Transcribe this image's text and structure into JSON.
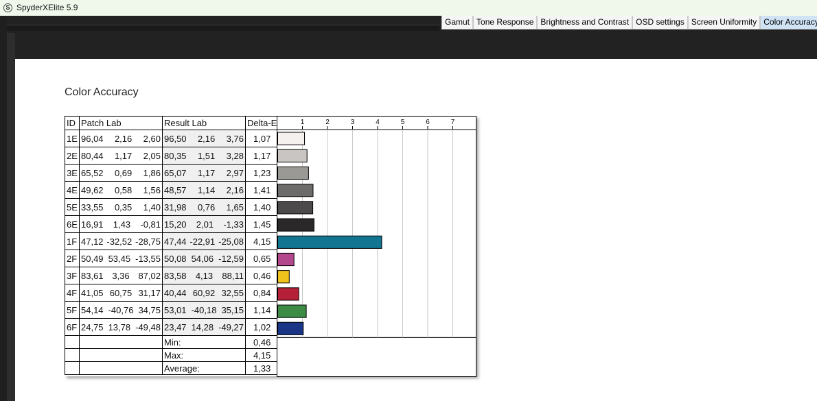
{
  "app": {
    "title": "SpyderXElite 5.9",
    "icon": "S"
  },
  "tabs": [
    "Gamut",
    "Tone Response",
    "Brightness and Contrast",
    "OSD settings",
    "Screen Uniformity",
    "Color Accuracy"
  ],
  "active_tab": "Color Accuracy",
  "section_title": "Color Accuracy",
  "table": {
    "headers": {
      "id": "ID",
      "patch": "Patch Lab",
      "result": "Result Lab",
      "delta": "Delta-E"
    },
    "rows": [
      {
        "id": "1E",
        "patch": [
          "96,04",
          "2,16",
          "2,60"
        ],
        "result": [
          "96,50",
          "2,16",
          "3,76"
        ],
        "delta": "1,07"
      },
      {
        "id": "2E",
        "patch": [
          "80,44",
          "1,17",
          "2,05"
        ],
        "result": [
          "80,35",
          "1,51",
          "3,28"
        ],
        "delta": "1,17"
      },
      {
        "id": "3E",
        "patch": [
          "65,52",
          "0,69",
          "1,86"
        ],
        "result": [
          "65,07",
          "1,17",
          "2,97"
        ],
        "delta": "1,23"
      },
      {
        "id": "4E",
        "patch": [
          "49,62",
          "0,58",
          "1,56"
        ],
        "result": [
          "48,57",
          "1,14",
          "2,16"
        ],
        "delta": "1,41"
      },
      {
        "id": "5E",
        "patch": [
          "33,55",
          "0,35",
          "1,40"
        ],
        "result": [
          "31,98",
          "0,76",
          "1,65"
        ],
        "delta": "1,40"
      },
      {
        "id": "6E",
        "patch": [
          "16,91",
          "1,43",
          "-0,81"
        ],
        "result": [
          "15,20",
          "2,01",
          "-1,33"
        ],
        "delta": "1,45"
      },
      {
        "id": "1F",
        "patch": [
          "47,12",
          "-32,52",
          "-28,75"
        ],
        "result": [
          "47,44",
          "-22,91",
          "-25,08"
        ],
        "delta": "4,15"
      },
      {
        "id": "2F",
        "patch": [
          "50,49",
          "53,45",
          "-13,55"
        ],
        "result": [
          "50,08",
          "54,06",
          "-12,59"
        ],
        "delta": "0,65"
      },
      {
        "id": "3F",
        "patch": [
          "83,61",
          "3,36",
          "87,02"
        ],
        "result": [
          "83,58",
          "4,13",
          "88,11"
        ],
        "delta": "0,46"
      },
      {
        "id": "4F",
        "patch": [
          "41,05",
          "60,75",
          "31,17"
        ],
        "result": [
          "40,44",
          "60,92",
          "32,55"
        ],
        "delta": "0,84"
      },
      {
        "id": "5F",
        "patch": [
          "54,14",
          "-40,76",
          "34,75"
        ],
        "result": [
          "53,01",
          "-40,18",
          "35,15"
        ],
        "delta": "1,14"
      },
      {
        "id": "6F",
        "patch": [
          "24,75",
          "13,78",
          "-49,48"
        ],
        "result": [
          "23,47",
          "14,28",
          "-49,27"
        ],
        "delta": "1,02"
      }
    ],
    "summary": [
      {
        "label": "Min:",
        "value": "0,46"
      },
      {
        "label": "Max:",
        "value": "4,15"
      },
      {
        "label": "Average:",
        "value": "1,33"
      }
    ]
  },
  "chart_data": {
    "type": "bar",
    "orientation": "horizontal",
    "categories": [
      "1E",
      "2E",
      "3E",
      "4E",
      "5E",
      "6E",
      "1F",
      "2F",
      "3F",
      "4F",
      "5F",
      "6F"
    ],
    "values": [
      1.07,
      1.17,
      1.23,
      1.41,
      1.4,
      1.45,
      4.15,
      0.65,
      0.46,
      0.84,
      1.14,
      1.02
    ],
    "colors": [
      "#f5f1ee",
      "#c8c5c2",
      "#9b9996",
      "#6d6b6a",
      "#4c4a4a",
      "#2a2828",
      "#127592",
      "#b3488c",
      "#f0c31c",
      "#b51f38",
      "#3d8c46",
      "#1a3585"
    ],
    "ticks": [
      1,
      2,
      3,
      4,
      5,
      6,
      7
    ],
    "xlim": [
      0,
      7.8
    ],
    "grid": true
  }
}
